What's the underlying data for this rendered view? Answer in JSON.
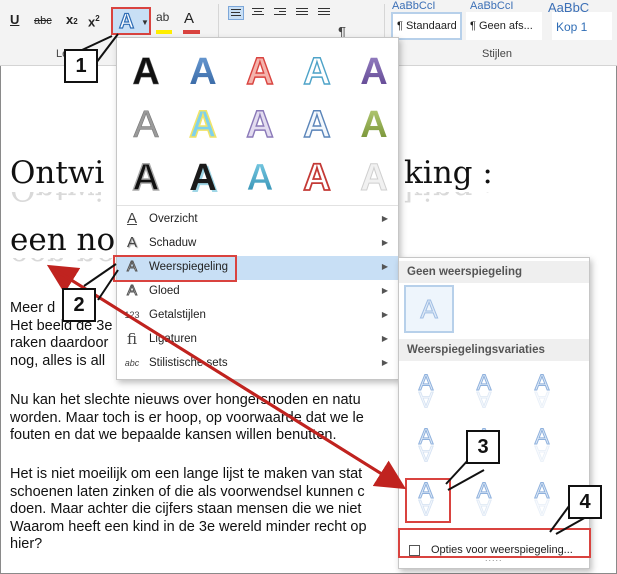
{
  "ribbon": {
    "underline": "U",
    "strike": "abc",
    "subscript": "x",
    "subscript_small": "2",
    "superscript": "x",
    "superscript_small": "2",
    "effects_icon": "A",
    "highlight_icon": "ab",
    "font_color_icon": "A",
    "pilcrow": "¶",
    "group_left_partial": "Le",
    "styles_label": "Stijlen",
    "style_standaard": "¶ Standaard",
    "style_geen": "¶ Geen afs...",
    "style_kop1": "Kop 1",
    "style_top_1": "AaBbCcI",
    "style_top_2": "AaBbCcI",
    "style_top_3": "AaBbC"
  },
  "document": {
    "title_line1": "Ontwikkeling :",
    "title_line1_left": "Ontwi",
    "title_line1_right": "king :",
    "title_line2": "een no",
    "p1": [
      "Meer d",
      "Het beeld de 3e",
      "raken daardoor",
      "nog, alles is all"
    ],
    "p2": [
      "Nu kan het slechte nieuws over hongersnoden en natu",
      "worden. Maar toch is er hoop, op voorwaarde dat we le",
      "fouten en dat we bepaalde kansen willen benutten."
    ],
    "p3": [
      "Het is niet moeilijk om een lange lijst te maken van stat",
      "schoenen laten zinken of die als voorwendsel kunnen c",
      "doen. Maar achter die cijfers staan mensen die we niet",
      "Waarom heeft een kind in de 3e wereld minder recht op",
      "hier?"
    ]
  },
  "menu": {
    "items": [
      {
        "icon": "A",
        "label": "Overzicht"
      },
      {
        "icon": "A",
        "label": "Schaduw"
      },
      {
        "icon": "A",
        "label": "Weerspiegeling"
      },
      {
        "icon": "A",
        "label": "Gloed"
      },
      {
        "icon": "123",
        "label": "Getalstijlen"
      },
      {
        "icon": "fi",
        "label": "Ligaturen"
      },
      {
        "icon": "abc",
        "label": "Stilistische sets"
      }
    ],
    "gallery_letter": "A"
  },
  "submenu": {
    "header_none": "Geen weerspiegeling",
    "header_variants": "Weerspiegelingsvariaties",
    "options_label": "Opties voor weerspiegeling...",
    "letter": "A",
    "dots": "....."
  },
  "callouts": [
    "1",
    "2",
    "3",
    "4"
  ],
  "colors": {
    "accent": "#2f6db5",
    "highlight": "#c8dff5",
    "annotation_red": "#d9433f"
  }
}
